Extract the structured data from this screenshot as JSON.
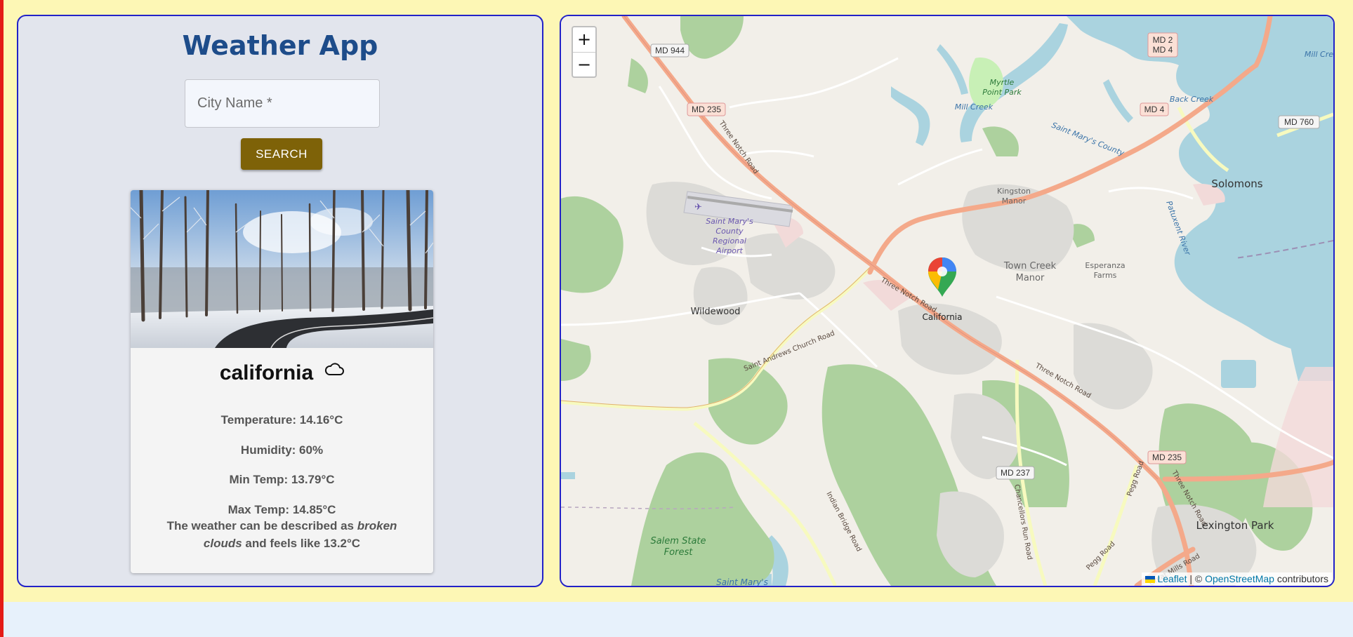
{
  "app": {
    "title": "Weather App"
  },
  "search": {
    "placeholder": "City Name *",
    "value": "",
    "button_label": "SEARCH"
  },
  "card": {
    "image_alt": "snowy forest road",
    "city": "california",
    "weather_icon": "cloud-icon",
    "temperature": "Temperature: 14.16°C",
    "humidity": "Humidity: 60%",
    "min_temp": "Min Temp: 13.79°C",
    "max_temp": "Max Temp: 14.85°C",
    "desc_prefix": "The weather can be described as ",
    "desc_condition": "broken clouds",
    "desc_suffix": " and feels like 13.2°C"
  },
  "map": {
    "zoom_in": "+",
    "zoom_out": "−",
    "marker_label": "California",
    "places": {
      "wildewood": "Wildewood",
      "solomons": "Solomons",
      "lexington_park": "Lexington Park",
      "town_creek_1": "Town Creek",
      "town_creek_2": "Manor",
      "esperanza_1": "Esperanza",
      "esperanza_2": "Farms",
      "kingston_1": "Kingston",
      "kingston_2": "Manor",
      "myrtle_1": "Myrtle",
      "myrtle_2": "Point Park",
      "mill_creek": "Mill Creek",
      "mill_creek_2": "Mill Cre",
      "back_creek": "Back Creek",
      "saint_marys_county": "Saint Mary's County",
      "patuxent": "Patuxent River",
      "airport_1": "Saint Mary's",
      "airport_2": "County",
      "airport_3": "Regional",
      "airport_4": "Airport",
      "salem_1": "Salem State",
      "salem_2": "Forest",
      "saint_marys_bottom": "Saint Mary's"
    },
    "roads": {
      "md944": "MD 944",
      "md235a": "MD 235",
      "md235b": "MD 235",
      "md2": "MD 2",
      "md4a": "MD 4",
      "md4b": "MD 4",
      "md760": "MD 760",
      "md237": "MD 237",
      "three_notch_1": "Three Notch Road",
      "three_notch_2": "Three Notch Road",
      "three_notch_3": "Three Notch Road",
      "three_notch_4": "Three Notch Road",
      "st_andrews": "Saint Andrews Church Road",
      "chancellors": "Chancellors Run Road",
      "indian_bridge": "Indian Bridge Road",
      "pegg_1": "Pegg Road",
      "pegg_2": "Pegg Road",
      "great_mills": "Great Mills Road"
    },
    "attribution": {
      "leaflet": "Leaflet",
      "sep": " | © ",
      "osm": "OpenStreetMap",
      "tail": " contributors"
    }
  },
  "colors": {
    "left_edge": "#e41b17",
    "page_band": "#fdf7b5",
    "panel_border": "#2222c8",
    "title": "#1d4c8a",
    "search_button": "#7e6208",
    "water": "#aad3df",
    "forest": "#add19e",
    "primary_road": "#f4a98a"
  }
}
